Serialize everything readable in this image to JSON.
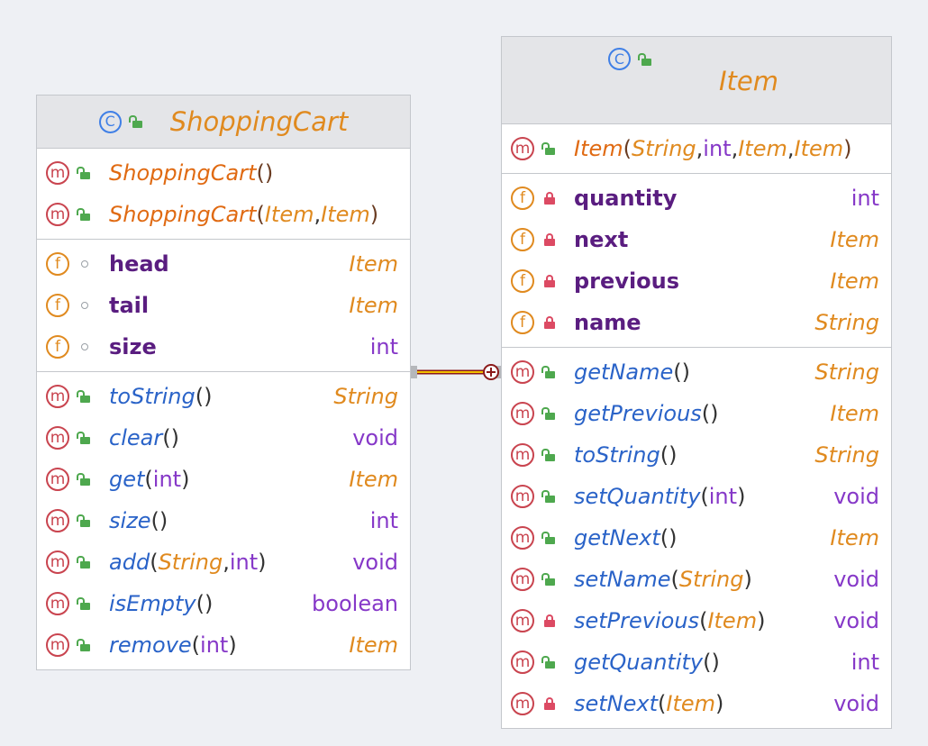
{
  "classes": {
    "shopping_cart": {
      "name": "ShoppingCart",
      "constructors": [
        {
          "name": "ShoppingCart",
          "params": []
        },
        {
          "name": "ShoppingCart",
          "params": [
            {
              "type": "Item",
              "prim": false
            },
            {
              "type": "Item",
              "prim": false
            }
          ]
        }
      ],
      "fields": [
        {
          "name": "head",
          "type": "Item",
          "prim": false,
          "vis": "pkg"
        },
        {
          "name": "tail",
          "type": "Item",
          "prim": false,
          "vis": "pkg"
        },
        {
          "name": "size",
          "type": "int",
          "prim": true,
          "vis": "pkg"
        }
      ],
      "methods": [
        {
          "name": "toString",
          "params": [],
          "ret": "String",
          "retPrim": false,
          "vis": "pub"
        },
        {
          "name": "clear",
          "params": [],
          "ret": "void",
          "retPrim": true,
          "vis": "pub"
        },
        {
          "name": "get",
          "params": [
            {
              "type": "int",
              "prim": true
            }
          ],
          "ret": "Item",
          "retPrim": false,
          "vis": "pub"
        },
        {
          "name": "size",
          "params": [],
          "ret": "int",
          "retPrim": true,
          "vis": "pub"
        },
        {
          "name": "add",
          "params": [
            {
              "type": "String",
              "prim": false
            },
            {
              "type": "int",
              "prim": true
            }
          ],
          "ret": "void",
          "retPrim": true,
          "vis": "pub"
        },
        {
          "name": "isEmpty",
          "params": [],
          "ret": "boolean",
          "retPrim": true,
          "vis": "pub"
        },
        {
          "name": "remove",
          "params": [
            {
              "type": "int",
              "prim": true
            }
          ],
          "ret": "Item",
          "retPrim": false,
          "vis": "pub"
        }
      ]
    },
    "item": {
      "name": "Item",
      "constructors": [
        {
          "name": "Item",
          "params": [
            {
              "type": "String",
              "prim": false
            },
            {
              "type": "int",
              "prim": true
            },
            {
              "type": "Item",
              "prim": false
            },
            {
              "type": "Item",
              "prim": false
            }
          ]
        }
      ],
      "fields": [
        {
          "name": "quantity",
          "type": "int",
          "prim": true,
          "vis": "priv"
        },
        {
          "name": "next",
          "type": "Item",
          "prim": false,
          "vis": "priv"
        },
        {
          "name": "previous",
          "type": "Item",
          "prim": false,
          "vis": "priv"
        },
        {
          "name": "name",
          "type": "String",
          "prim": false,
          "vis": "priv"
        }
      ],
      "methods": [
        {
          "name": "getName",
          "params": [],
          "ret": "String",
          "retPrim": false,
          "vis": "pub"
        },
        {
          "name": "getPrevious",
          "params": [],
          "ret": "Item",
          "retPrim": false,
          "vis": "pub"
        },
        {
          "name": "toString",
          "params": [],
          "ret": "String",
          "retPrim": false,
          "vis": "pub"
        },
        {
          "name": "setQuantity",
          "params": [
            {
              "type": "int",
              "prim": true
            }
          ],
          "ret": "void",
          "retPrim": true,
          "vis": "pub"
        },
        {
          "name": "getNext",
          "params": [],
          "ret": "Item",
          "retPrim": false,
          "vis": "pub"
        },
        {
          "name": "setName",
          "params": [
            {
              "type": "String",
              "prim": false
            }
          ],
          "ret": "void",
          "retPrim": true,
          "vis": "pub"
        },
        {
          "name": "setPrevious",
          "params": [
            {
              "type": "Item",
              "prim": false
            }
          ],
          "ret": "void",
          "retPrim": true,
          "vis": "priv"
        },
        {
          "name": "getQuantity",
          "params": [],
          "ret": "int",
          "retPrim": true,
          "vis": "pub"
        },
        {
          "name": "setNext",
          "params": [
            {
              "type": "Item",
              "prim": false
            }
          ],
          "ret": "void",
          "retPrim": true,
          "vis": "priv"
        }
      ]
    }
  },
  "symbols": {
    "class_kind": "C",
    "method_kind": "m",
    "field_kind": "f",
    "paren_open": "(",
    "paren_close": ")",
    "separator": ", "
  },
  "relation": {
    "from": "ShoppingCart",
    "to": "Item",
    "type": "nested-class",
    "color": "#e6b400",
    "end_color": "#8b1a1a"
  }
}
